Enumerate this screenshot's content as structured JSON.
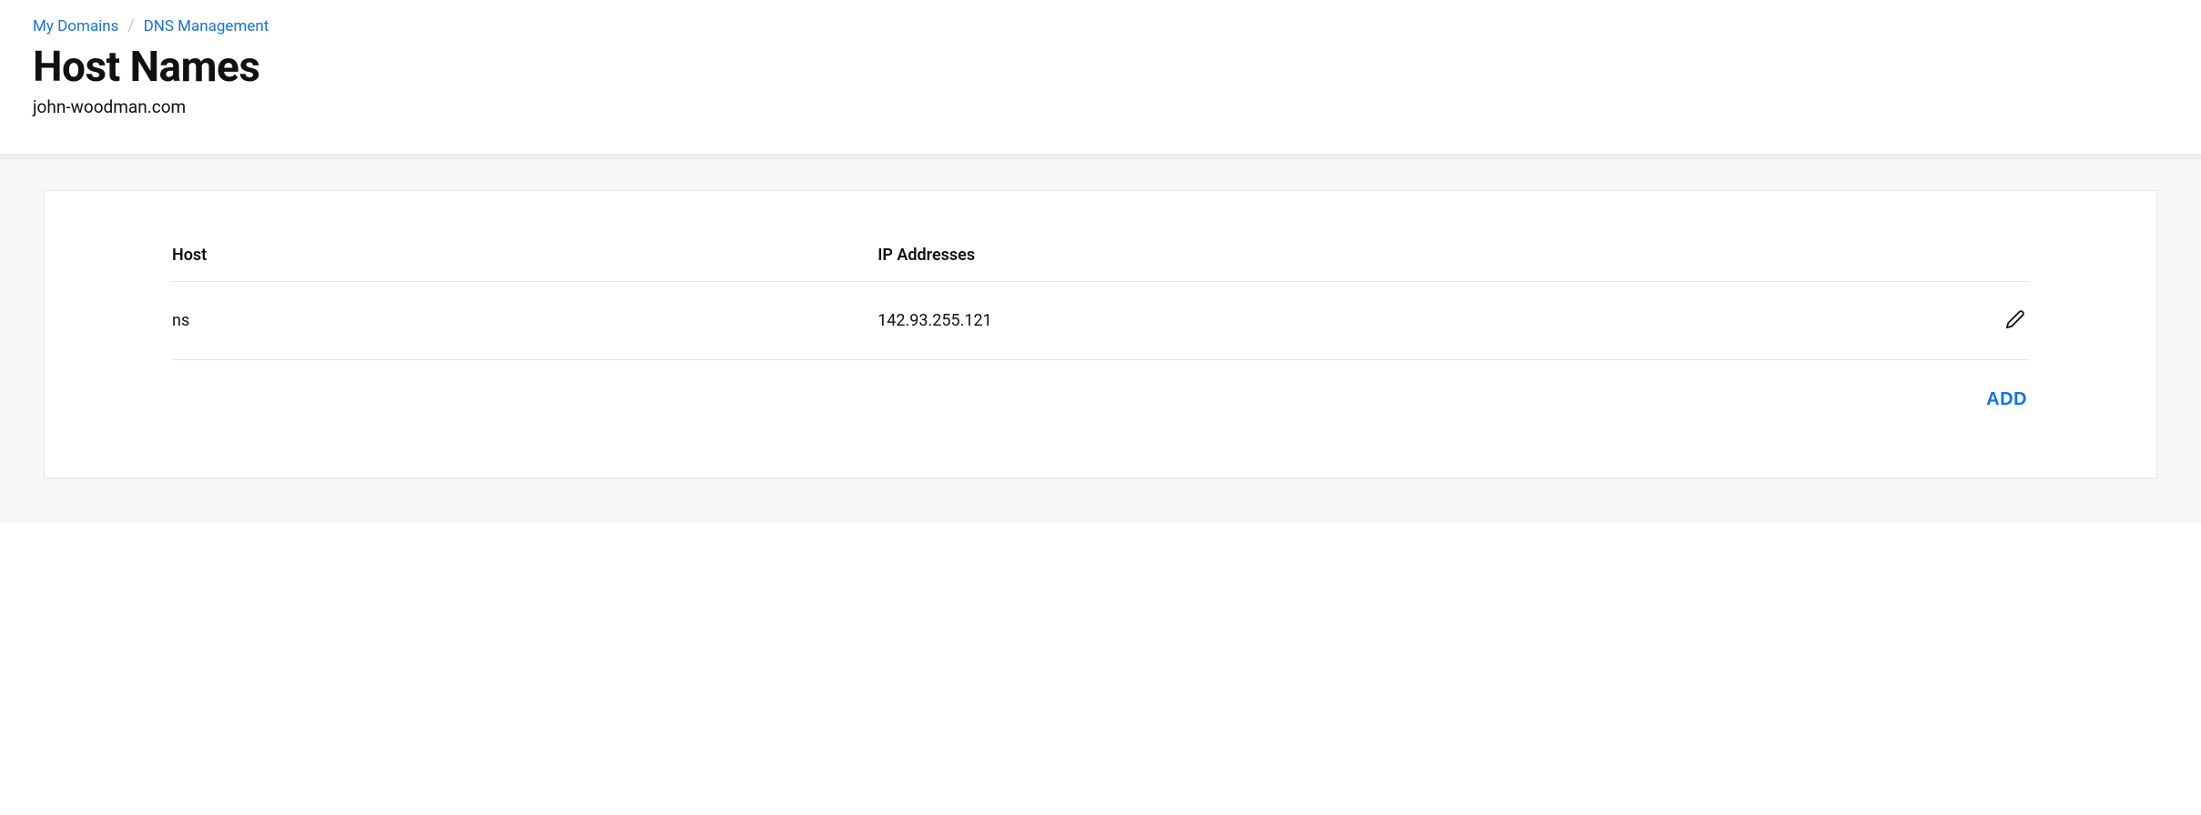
{
  "breadcrumb": {
    "items": [
      {
        "label": "My Domains"
      },
      {
        "label": "DNS Management"
      }
    ]
  },
  "page": {
    "title": "Host Names",
    "subtitle": "john-woodman.com"
  },
  "table": {
    "columns": {
      "host": "Host",
      "ip": "IP Addresses"
    },
    "rows": [
      {
        "host": "ns",
        "ip": "142.93.255.121"
      }
    ]
  },
  "actions": {
    "add": "ADD"
  }
}
